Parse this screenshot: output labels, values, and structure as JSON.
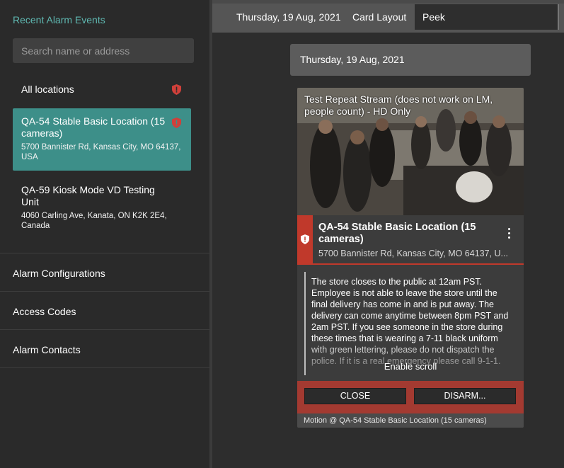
{
  "sidebar": {
    "title": "Recent Alarm Events",
    "search_placeholder": "Search name or address",
    "locations": [
      {
        "name": "All locations"
      },
      {
        "name": "QA-54 Stable Basic Location (15 cameras)",
        "address": "5700 Bannister Rd, Kansas City, MO 64137, USA"
      },
      {
        "name": "QA-59 Kiosk Mode VD Testing Unit",
        "address": "4060 Carling Ave, Kanata, ON K2K 2E4, Canada"
      }
    ],
    "nav": [
      "Alarm Configurations",
      "Access Codes",
      "Alarm Contacts"
    ]
  },
  "topbar": {
    "date": "Thursday, 19 Aug, 2021",
    "layout_label": "Card Layout",
    "view_value": "Peek"
  },
  "date_banner": "Thursday, 19 Aug, 2021",
  "card": {
    "video_title": "Test Repeat Stream (does not work on LM, people count) - HD Only",
    "location_name": "QA-54 Stable Basic Location (15 cameras)",
    "location_address": "5700 Bannister Rd, Kansas City, MO 64137, U...",
    "notes": "The store closes to the public at 12am PST. Employee is not able to leave the store until the final delivery has come in and is put away. The delivery can come anytime between 8pm PST and 2am PST. If you see someone in the store during these times that is wearing a 7-11 black uniform with green lettering, please do not dispatch the police. If it is a real emergency please call 9-1-1.",
    "enable_scroll": "Enable scroll",
    "close_label": "CLOSE",
    "disarm_label": "DISARM...",
    "footer": "Motion @ QA-54 Stable Basic Location (15 cameras)"
  },
  "colors": {
    "accent_teal": "#5fb8b1",
    "selected_bg": "#3d8f89",
    "alarm_red": "#c0392b",
    "action_bar": "#a33a31"
  },
  "icons": [
    "shield-alert-icon",
    "kebab-menu-icon"
  ]
}
